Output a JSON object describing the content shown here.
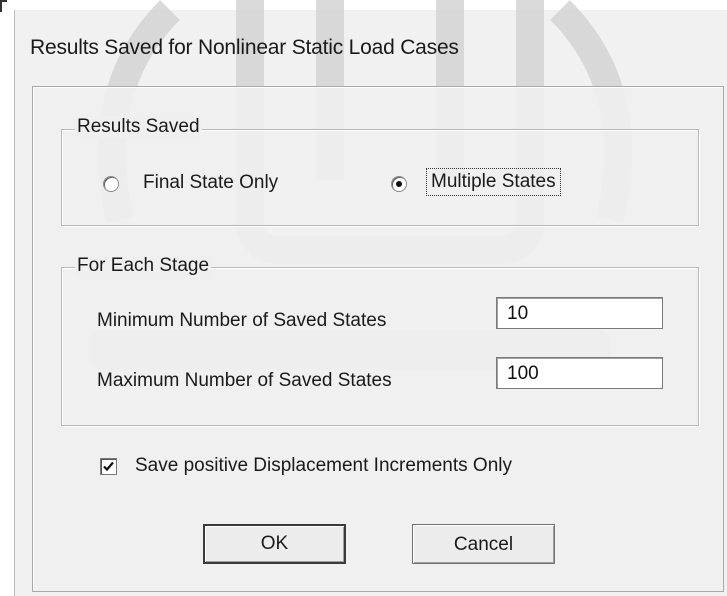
{
  "window": {
    "title": "Results Saved for Nonlinear Static Load Cases"
  },
  "results_saved": {
    "caption": "Results Saved",
    "options": [
      {
        "label": "Final State Only",
        "selected": false
      },
      {
        "label": "Multiple States",
        "selected": true
      }
    ]
  },
  "each_stage": {
    "caption": "For Each Stage",
    "min_label": "Minimum Number of Saved States",
    "min_value": "10",
    "max_label": "Maximum Number of Saved States",
    "max_value": "100"
  },
  "options": {
    "positive_displacement_label": "Save positive Displacement Increments Only",
    "positive_displacement_checked": true
  },
  "buttons": {
    "ok_label": "OK",
    "cancel_label": "Cancel"
  },
  "colors": {
    "dialog_background": "#f0f0f0",
    "watermark": "#d8d8d8"
  },
  "icons": {
    "watermark": "university-seal-watermark",
    "check": "checkmark-icon"
  }
}
